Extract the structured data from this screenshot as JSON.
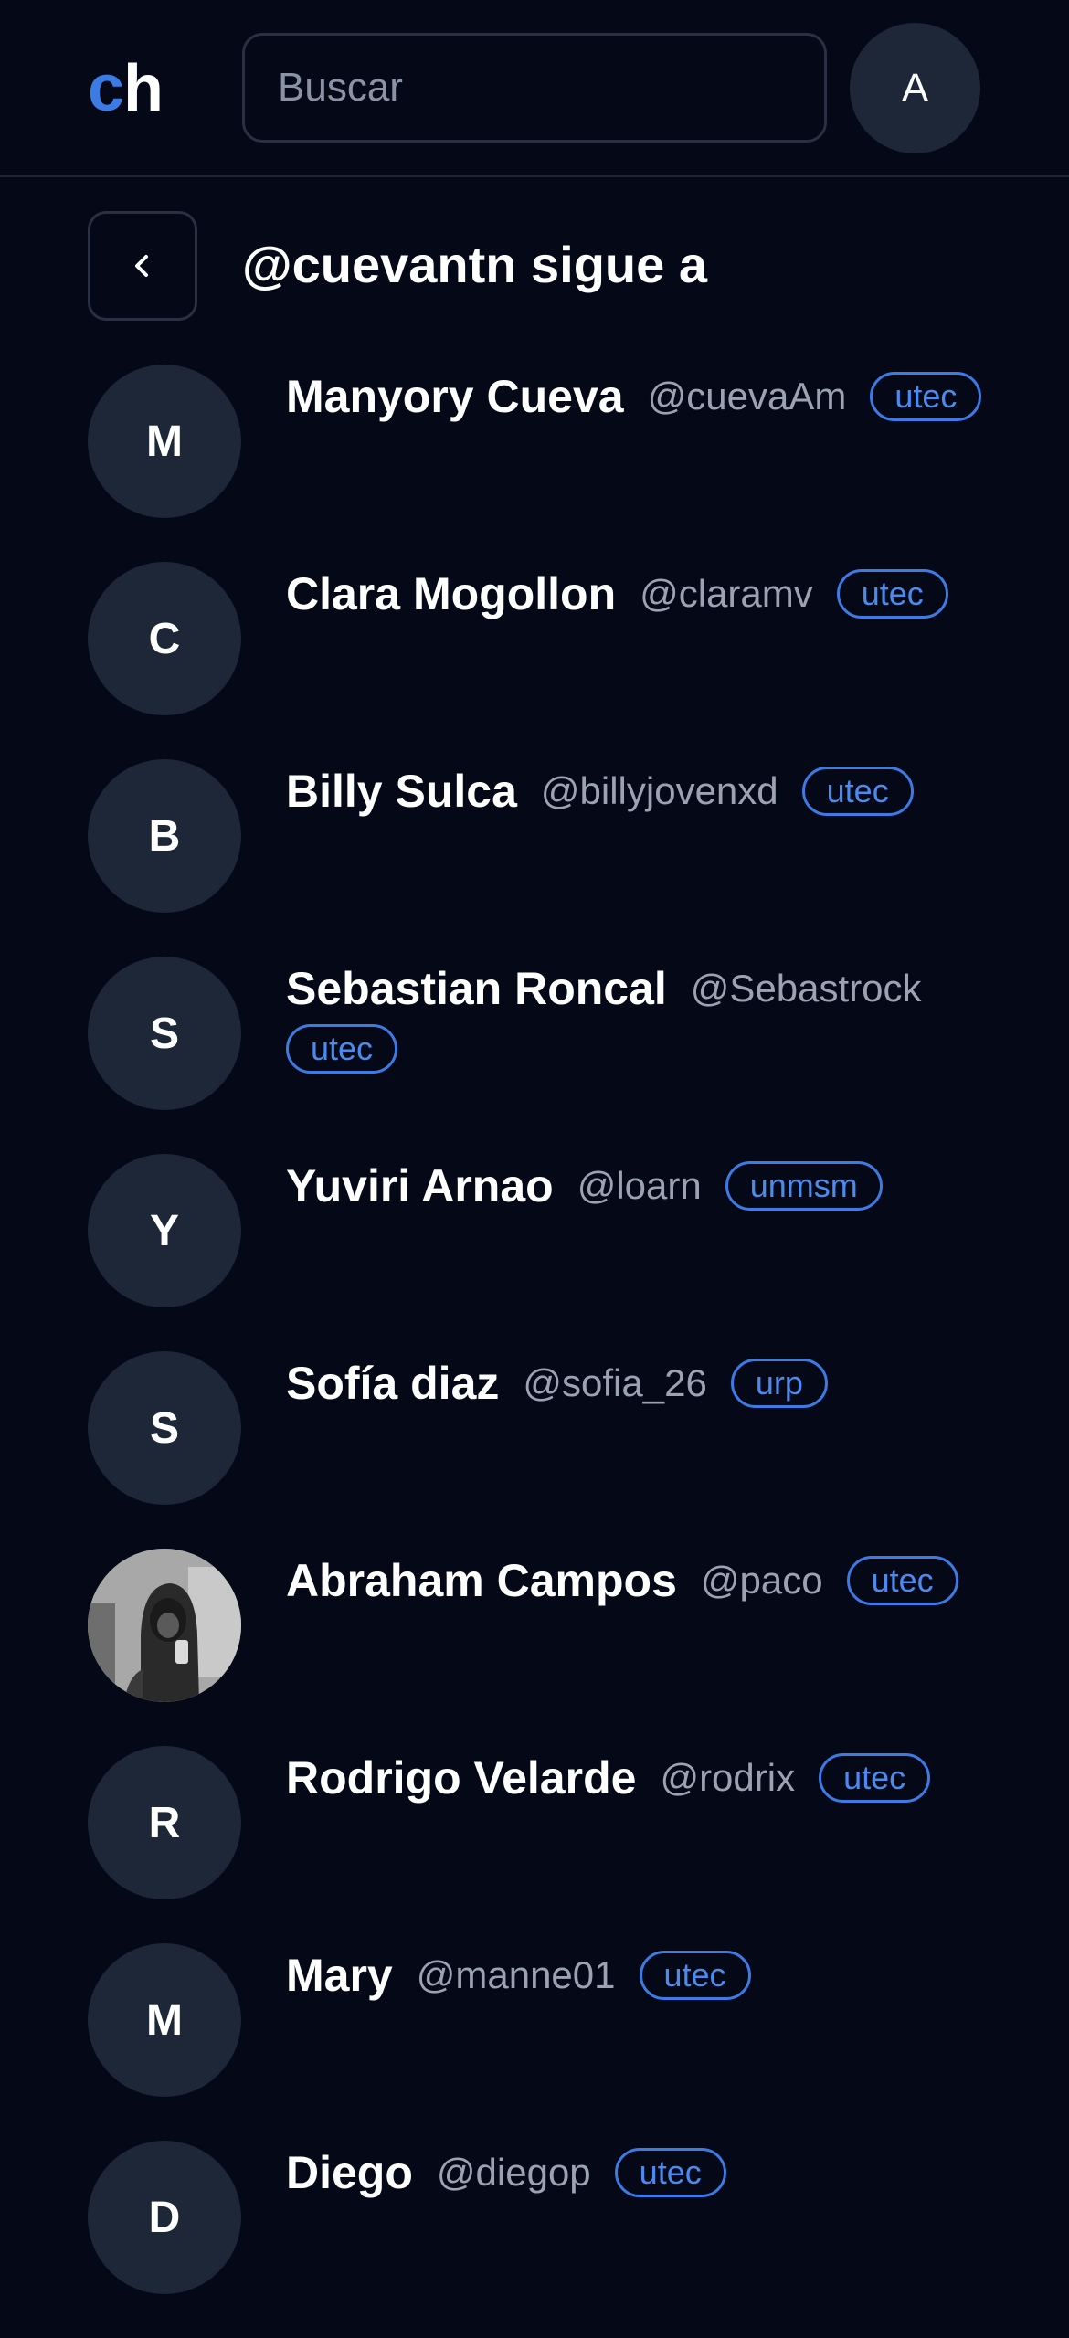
{
  "header": {
    "logo_c": "c",
    "logo_h": "h",
    "search_placeholder": "Buscar",
    "user_initial": "A"
  },
  "page": {
    "title": "@cuevantn sigue a"
  },
  "colors": {
    "background": "#040817",
    "accent": "#3b7be3",
    "avatar_bg": "#1e2738",
    "muted_text": "#9ba3b3",
    "border": "#283041"
  },
  "users": [
    {
      "initial": "M",
      "name": "Manyory Cueva",
      "handle": "@cuevaAm",
      "badge": "utec"
    },
    {
      "initial": "C",
      "name": "Clara Mogollon",
      "handle": "@claramv",
      "badge": "utec"
    },
    {
      "initial": "B",
      "name": "Billy Sulca",
      "handle": "@billyjovenxd",
      "badge": "utec"
    },
    {
      "initial": "S",
      "name": "Sebastian Roncal",
      "handle": "@Sebastrock",
      "badge": "utec"
    },
    {
      "initial": "Y",
      "name": "Yuviri Arnao",
      "handle": "@loarn",
      "badge": "unmsm"
    },
    {
      "initial": "S",
      "name": "Sofía diaz",
      "handle": "@sofia_26",
      "badge": "urp"
    },
    {
      "initial": "",
      "name": "Abraham Campos",
      "handle": "@paco",
      "badge": "utec",
      "photo": true
    },
    {
      "initial": "R",
      "name": "Rodrigo Velarde",
      "handle": "@rodrix",
      "badge": "utec"
    },
    {
      "initial": "M",
      "name": "Mary",
      "handle": "@manne01",
      "badge": "utec"
    },
    {
      "initial": "D",
      "name": "Diego",
      "handle": "@diegop",
      "badge": "utec"
    }
  ]
}
